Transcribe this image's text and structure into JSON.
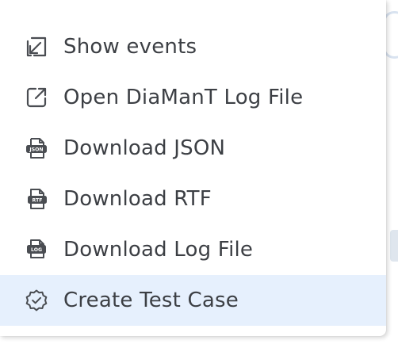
{
  "menu": {
    "items": [
      {
        "label": "Show events",
        "icon": "arrow-down-left-box-icon"
      },
      {
        "label": "Open DiaManT Log File",
        "icon": "external-link-icon"
      },
      {
        "label": "Download JSON",
        "icon": "json-file-icon",
        "badge": "JSON"
      },
      {
        "label": "Download RTF",
        "icon": "rtf-file-icon",
        "badge": "RTF"
      },
      {
        "label": "Download Log File",
        "icon": "log-file-icon",
        "badge": "LOG"
      },
      {
        "label": "Create Test Case",
        "icon": "badge-check-icon"
      }
    ],
    "highlight_color": "#e6f0fd",
    "text_color": "#3c3f44",
    "icon_color": "#4a4d52"
  }
}
